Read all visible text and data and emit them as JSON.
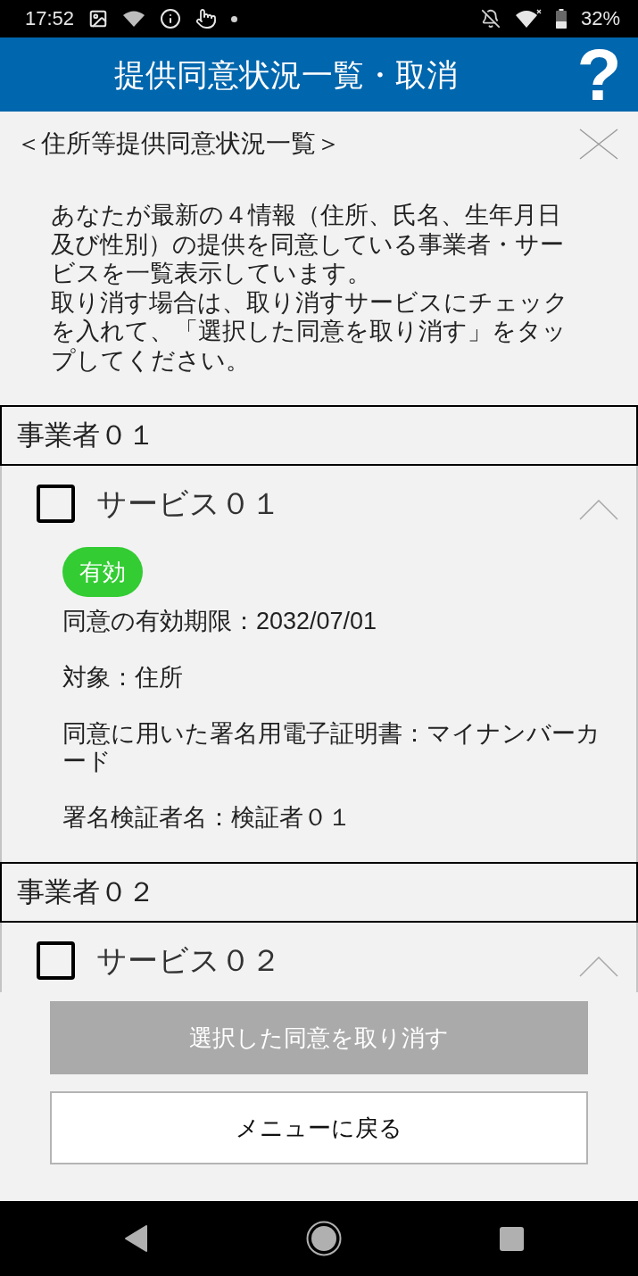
{
  "status_bar": {
    "time": "17:52",
    "battery": "32%"
  },
  "header": {
    "title": "提供同意状況一覧・取消",
    "help": "?"
  },
  "section": {
    "title": "＜住所等提供同意状況一覧＞",
    "intro": [
      "あなたが最新の４情報（住所、氏名、生年月日及び性別）の提供を同意している事業者・サービスを一覧表示しています。",
      "取り消す場合は、取り消すサービスにチェックを入れて、「選択した同意を取り消す」をタップしてください。"
    ]
  },
  "providers": [
    {
      "name": "事業者０１",
      "services": [
        {
          "name": "サービス０１",
          "checked": false,
          "expanded": true,
          "status": {
            "label": "有効",
            "kind": "valid"
          },
          "details": [
            "同意の有効期限：2032/07/01",
            "対象：住所",
            "同意に用いた署名用電子証明書：マイナンバーカード",
            "署名検証者名：検証者０１"
          ]
        }
      ]
    },
    {
      "name": "事業者０２",
      "services": [
        {
          "name": "サービス０２",
          "checked": false,
          "expanded": true
        }
      ]
    }
  ],
  "actions": [
    {
      "label": "選択した同意を取り消す",
      "kind": "primary",
      "disabled": true
    },
    {
      "label": "メニューに戻る",
      "kind": "secondary",
      "disabled": false
    }
  ]
}
